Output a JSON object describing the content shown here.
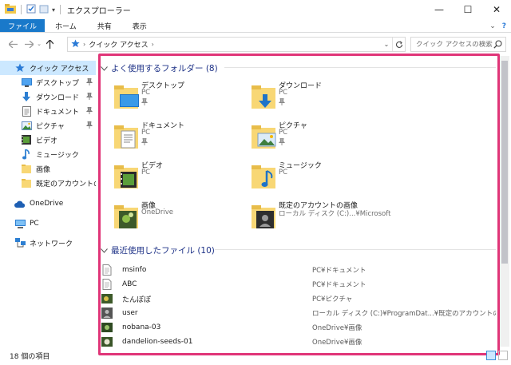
{
  "window": {
    "title": "エクスプローラー",
    "controls": {
      "minimize": "—",
      "maximize": "☐",
      "close": "✕"
    }
  },
  "ribbon": {
    "tabs": [
      "ファイル",
      "ホーム",
      "共有",
      "表示"
    ],
    "expand": "⌄",
    "help": "?"
  },
  "address": {
    "path": "クイック アクセス",
    "search_placeholder": "クイック アクセスの検索"
  },
  "sidebar": {
    "items": [
      {
        "label": "クイック アクセス",
        "icon": "star-icon",
        "pinned": false,
        "selected": true
      },
      {
        "label": "デスクトップ",
        "icon": "desktop-icon",
        "pinned": true
      },
      {
        "label": "ダウンロード",
        "icon": "download-icon",
        "pinned": true
      },
      {
        "label": "ドキュメント",
        "icon": "document-icon",
        "pinned": true
      },
      {
        "label": "ピクチャ",
        "icon": "picture-icon",
        "pinned": true
      },
      {
        "label": "ビデオ",
        "icon": "video-icon",
        "pinned": false
      },
      {
        "label": "ミュージック",
        "icon": "music-icon",
        "pinned": false
      },
      {
        "label": "画像",
        "icon": "folder-icon",
        "pinned": false
      },
      {
        "label": "既定のアカウントの画像",
        "icon": "folder-icon",
        "pinned": false
      },
      {
        "label": "OneDrive",
        "icon": "cloud-icon",
        "pinned": false
      },
      {
        "label": "PC",
        "icon": "pc-icon",
        "pinned": false
      },
      {
        "label": "ネットワーク",
        "icon": "network-icon",
        "pinned": false
      }
    ]
  },
  "frequent": {
    "header": "よく使用するフォルダー (8)",
    "folders": [
      {
        "name": "デスクトップ",
        "location": "PC",
        "pinned": true,
        "icon": "desktop-folder-icon"
      },
      {
        "name": "ダウンロード",
        "location": "PC",
        "pinned": true,
        "icon": "download-folder-icon"
      },
      {
        "name": "ドキュメント",
        "location": "PC",
        "pinned": true,
        "icon": "documents-folder-icon"
      },
      {
        "name": "ピクチャ",
        "location": "PC",
        "pinned": true,
        "icon": "pictures-folder-icon"
      },
      {
        "name": "ビデオ",
        "location": "PC",
        "pinned": false,
        "icon": "videos-folder-icon"
      },
      {
        "name": "ミュージック",
        "location": "PC",
        "pinned": false,
        "icon": "music-folder-icon"
      },
      {
        "name": "画像",
        "location": "OneDrive",
        "pinned": false,
        "icon": "image-folder-icon"
      },
      {
        "name": "既定のアカウントの画像",
        "location": "ローカル ディスク (C:)...¥Microsoft",
        "pinned": false,
        "icon": "account-pictures-folder-icon"
      }
    ]
  },
  "recent": {
    "header": "最近使用したファイル (10)",
    "files": [
      {
        "name": "msinfo",
        "path": "PC¥ドキュメント",
        "icon": "text-file-icon"
      },
      {
        "name": "ABC",
        "path": "PC¥ドキュメント",
        "icon": "text-file-icon"
      },
      {
        "name": "たんぽぽ",
        "path": "PC¥ピクチャ",
        "icon": "image-file-icon"
      },
      {
        "name": "user",
        "path": "ローカル ディスク (C:)¥ProgramDat...¥既定のアカウントの画像",
        "icon": "user-image-icon"
      },
      {
        "name": "nobana-03",
        "path": "OneDrive¥画像",
        "icon": "image-file-icon"
      },
      {
        "name": "dandelion-seeds-01",
        "path": "OneDrive¥画像",
        "icon": "image-file-icon"
      }
    ]
  },
  "status": {
    "item_count": "18 個の項目"
  },
  "colors": {
    "accent": "#1979ca",
    "selection": "#cce8ff",
    "group_header": "#1e3287",
    "highlight_border": "#e03578",
    "folder_yellow": "#f8d775"
  }
}
